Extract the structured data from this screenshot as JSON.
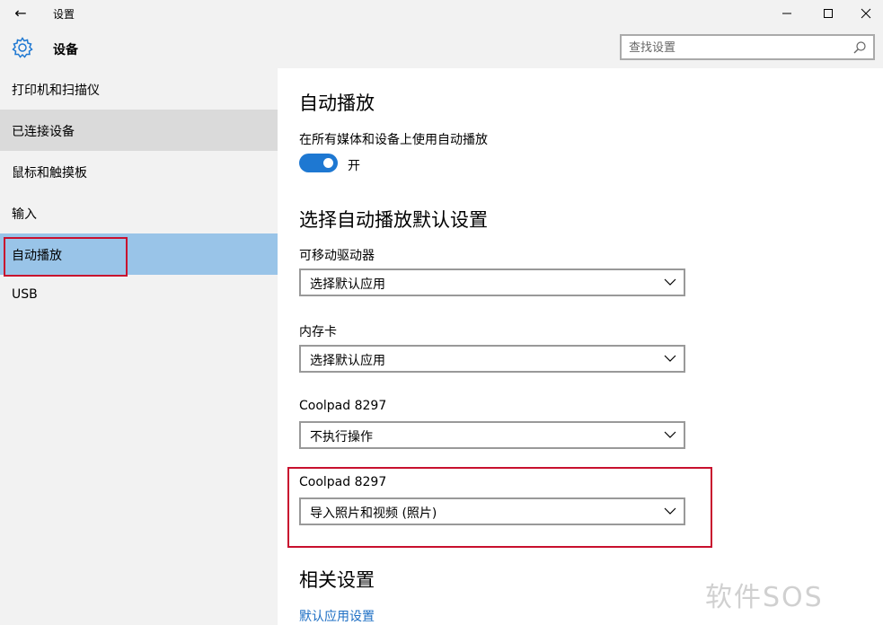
{
  "window": {
    "title": "设置",
    "back_glyph": "←"
  },
  "sidebar": {
    "title": "设备",
    "items": [
      {
        "label": "打印机和扫描仪"
      },
      {
        "label": "已连接设备"
      },
      {
        "label": "鼠标和触摸板"
      },
      {
        "label": "输入"
      },
      {
        "label": "自动播放"
      },
      {
        "label": "USB"
      }
    ],
    "selected": "自动播放"
  },
  "search": {
    "placeholder": "查找设置"
  },
  "main": {
    "autoplay_heading": "自动播放",
    "autoplay_desc": "在所有媒体和设备上使用自动播放",
    "toggle_state": "开",
    "defaults_heading": "选择自动播放默认设置",
    "dropdowns": [
      {
        "label": "可移动驱动器",
        "value": "选择默认应用"
      },
      {
        "label": "内存卡",
        "value": "选择默认应用"
      },
      {
        "label": "Coolpad 8297",
        "value": "不执行操作"
      },
      {
        "label": "Coolpad 8297",
        "value": "导入照片和视频 (照片)"
      }
    ],
    "related_heading": "相关设置",
    "related_link": "默认应用设置"
  },
  "watermark": "软件SOS",
  "colors": {
    "accent": "#1e78d2",
    "selected_bg": "#99c4e8",
    "highlight_border": "#c8102e",
    "link": "#1e6fc4"
  }
}
